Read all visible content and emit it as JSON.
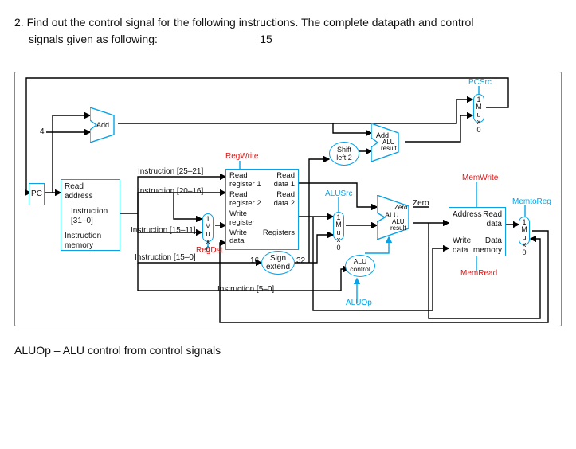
{
  "question": {
    "num": "2.",
    "text_a": "Find out the control signal for the following instructions. The complete datapath and control",
    "text_b": "signals given as following:",
    "points": "15"
  },
  "diagram": {
    "pc": "PC",
    "read_address": "Read\naddress",
    "instruction_range": "Instruction\n[31–0]",
    "instruction_memory": "Instruction\nmemory",
    "add1": "Add",
    "const_4": "4",
    "instr_25_21": "Instruction [25–21]",
    "instr_20_16": "Instruction [20–16]",
    "instr_15_11": "Instruction [15–11]",
    "instr_15_0": "Instruction [15–0]",
    "instr_5_0": "Instruction [5–0]",
    "mux10": "1\nM\nu\nx\n0",
    "mux01": "0\nM\nu\nx\n1",
    "regdst": "RegDst",
    "regwrite": "RegWrite",
    "registers_title": "Registers",
    "read_reg1": "Read\nregister 1",
    "read_reg2": "Read\nregister 2",
    "write_reg": "Write\nregister",
    "write_data": "Write\ndata",
    "read_data1": "Read\ndata 1",
    "read_data2": "Read\ndata 2",
    "sign_extend": "Sign\nextend",
    "sign_in": "16",
    "sign_out": "32",
    "alusrc": "ALUSrc",
    "alu_control": "ALU\ncontrol",
    "aluop": "ALUOp",
    "shift_left2": "Shift\nleft 2",
    "add2": "Add",
    "alu_result_small": "ALU\nresult",
    "zero": "Zero",
    "alu": "ALU",
    "alu_result_main": "ALU\nresult",
    "pcsrc": "PCSrc",
    "memwrite": "MemWrite",
    "memread": "MemRead",
    "memtoreg": "MemtoReg",
    "address": "Address",
    "read_data": "Read\ndata",
    "write_data_mem": "Write\ndata",
    "data_memory": "Data\nmemory"
  },
  "footer": {
    "note": "ALUOp – ALU control from control signals"
  }
}
